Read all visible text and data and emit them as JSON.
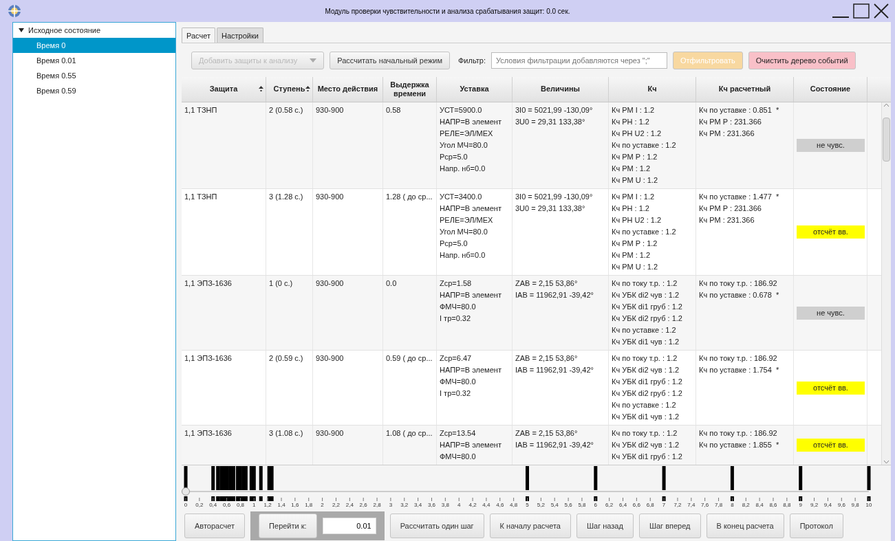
{
  "window": {
    "title": "Модуль проверки чувствительности и анализа срабатывания защит: 0.0 сек."
  },
  "tree": {
    "label": "Исходное состояние",
    "expanded": true,
    "children": [
      {
        "label": "Время 0",
        "selected": true
      },
      {
        "label": "Время 0.01",
        "selected": false
      },
      {
        "label": "Время 0.55",
        "selected": false
      },
      {
        "label": "Время 0.59",
        "selected": false
      }
    ]
  },
  "tabs": [
    {
      "label": "Расчет",
      "selected": true
    },
    {
      "label": "Настройки",
      "selected": false
    }
  ],
  "toolbar": {
    "add_dropdown": {
      "label": "Добавить защиты к анализу",
      "disabled": true
    },
    "initial_button": {
      "label": "Рассчитать начальный режим",
      "disabled": false
    },
    "filter_label": "Фильтр:",
    "filter_field": {
      "placeholder": "Условия фильтрации добавляются через \";\""
    },
    "filter_button": {
      "label": "Отфильтровать",
      "disabled": true
    },
    "clear_button": {
      "label": "Очистить дерево событий",
      "disabled": false
    }
  },
  "table": {
    "columns": [
      {
        "label": "Защита",
        "sorted": true
      },
      {
        "label": "Ступень",
        "sorted": true
      },
      {
        "label": "Место действия",
        "sorted": false
      },
      {
        "label": "Выдержка времени",
        "sorted": false
      },
      {
        "label": "Уставка",
        "sorted": false
      },
      {
        "label": "Величины",
        "sorted": false
      },
      {
        "label": "Кч",
        "sorted": false
      },
      {
        "label": "Кч расчетный",
        "sorted": false
      },
      {
        "label": "Состояние",
        "sorted": false
      }
    ],
    "rows": [
      {
        "protection": "1,1 ТЗНП",
        "stage": "2 (0.58 с.)",
        "place": "930-900",
        "delay": "0.58",
        "settings": [
          "УСТ=5900.0",
          "НАПР=В элемент",
          "РЕЛЕ=ЭЛ/МЕХ",
          "Угол МЧ=80.0",
          "Рср=5.0",
          "Напр. нб=0.0"
        ],
        "values": [
          "3I0 = 5021,99 -130,09°",
          "3U0 = 29,31 133,38°"
        ],
        "kch": [
          "Кч РМ I : 1.2",
          "Кч РН : 1.2",
          "Кч РН U2 : 1.2",
          "Кч по уставке : 1.2",
          "Кч РМ Р : 1.2",
          "Кч РМ : 1.2",
          "Кч РМ U : 1.2"
        ],
        "kch_calc": [
          "Кч по уставке : 0.851  *",
          "Кч РМ Р : 231.366",
          "Кч РМ : 231.366"
        ],
        "status": {
          "label": "не чувс.",
          "kind": "insensitive"
        }
      },
      {
        "protection": "1,1 ТЗНП",
        "stage": "3 (1.28 с.)",
        "place": "930-900",
        "delay": "1.28 ( до ср...",
        "settings": [
          "УСТ=3400.0",
          "НАПР=В элемент",
          "РЕЛЕ=ЭЛ/МЕХ",
          "Угол МЧ=80.0",
          "Рср=5.0",
          "Напр. нб=0.0"
        ],
        "values": [
          "3I0 = 5021,99 -130,09°",
          "3U0 = 29,31 133,38°"
        ],
        "kch": [
          "Кч РМ I : 1.2",
          "Кч РН : 1.2",
          "Кч РН U2 : 1.2",
          "Кч по уставке : 1.2",
          "Кч РМ Р : 1.2",
          "Кч РМ : 1.2",
          "Кч РМ U : 1.2"
        ],
        "kch_calc": [
          "Кч по уставке : 1.477  *",
          "Кч РМ Р : 231.366",
          "Кч РМ : 231.366"
        ],
        "status": {
          "label": "отсчёт вв.",
          "kind": "countdown"
        }
      },
      {
        "protection": "1,1 ЭПЗ-1636",
        "stage": "1 (0 с.)",
        "place": "930-900",
        "delay": "0.0",
        "settings": [
          "Zср=1.58",
          "НАПР=В элемент",
          "ФМЧ=80.0",
          "I тр=0.32"
        ],
        "values": [
          "ZAB = 2,15 53,86°",
          "IAB = 11962,91 -39,42°"
        ],
        "kch": [
          "Кч по току т.р. : 1.2",
          "Кч УБК di2 чув : 1.2",
          "Кч УБК di1 груб : 1.2",
          "Кч УБК di2 груб : 1.2",
          "Кч по уставке : 1.2",
          "Кч УБК di1 чув : 1.2"
        ],
        "kch_calc": [
          "Кч по току т.р. : 186.92",
          "Кч по уставке : 0.678  *"
        ],
        "status": {
          "label": "не чувс.",
          "kind": "insensitive"
        }
      },
      {
        "protection": "1,1 ЭПЗ-1636",
        "stage": "2 (0.59 с.)",
        "place": "930-900",
        "delay": "0.59 ( до ср...",
        "settings": [
          "Zср=6.47",
          "НАПР=В элемент",
          "ФМЧ=80.0",
          "I тр=0.32"
        ],
        "values": [
          "ZAB = 2,15 53,86°",
          "IAB = 11962,91 -39,42°"
        ],
        "kch": [
          "Кч по току т.р. : 1.2",
          "Кч УБК di2 чув : 1.2",
          "Кч УБК di1 груб : 1.2",
          "Кч УБК di2 груб : 1.2",
          "Кч по уставке : 1.2",
          "Кч УБК di1 чув : 1.2"
        ],
        "kch_calc": [
          "Кч по току т.р. : 186.92",
          "Кч по уставке : 1.754  *"
        ],
        "status": {
          "label": "отсчёт вв.",
          "kind": "countdown"
        }
      },
      {
        "protection": "1,1 ЭПЗ-1636",
        "stage": "3 (1.08 с.)",
        "place": "930-900",
        "delay": "1.08 ( до ср...",
        "settings": [
          "Zср=13.54",
          "НАПР=В элемент",
          "ФМЧ=80.0"
        ],
        "values": [
          "ZAB = 2,15 53,86°",
          "IAB = 11962,91 -39,42°"
        ],
        "kch": [
          "Кч по току т.р. : 1.2",
          "Кч УБК di2 чув : 1.2",
          "Кч УБК di1 груб : 1.2"
        ],
        "kch_calc": [
          "Кч по току т.р. : 186.92",
          "Кч по уставке : 1.855  *"
        ],
        "status": {
          "label": "отсчёт вв.",
          "kind": "countdown"
        }
      }
    ]
  },
  "timeline": {
    "level": 0,
    "tick_labels": [
      "0",
      "0,2",
      "0,4",
      "0,6",
      "0,8",
      "1",
      "1,2",
      "1,4",
      "1,6",
      "1,8",
      "2",
      "2,2",
      "2,4",
      "2,6",
      "2,8",
      "3",
      "3,2",
      "3,4",
      "3,6",
      "3,8",
      "4",
      "4,2",
      "4,4",
      "4,6",
      "4,8",
      "5",
      "5,2",
      "5,4",
      "5,6",
      "5,8",
      "6",
      "6,2",
      "6,4",
      "6,6",
      "6,8",
      "7",
      "7,2",
      "7,4",
      "7,6",
      "7,8",
      "8",
      "8,2",
      "8,4",
      "8,6",
      "8,8",
      "9",
      "9,2",
      "9,4",
      "9,6",
      "9,8",
      "10"
    ]
  },
  "bottom": {
    "auto_button": "Авторасчет",
    "goto_button": "Перейти к:",
    "goto_value": "0.01",
    "buttons": [
      "Рассчитать один шаг",
      "К началу расчета",
      "Шаг назад",
      "Шаг вперед",
      "В конец расчета",
      "Протокол"
    ]
  }
}
